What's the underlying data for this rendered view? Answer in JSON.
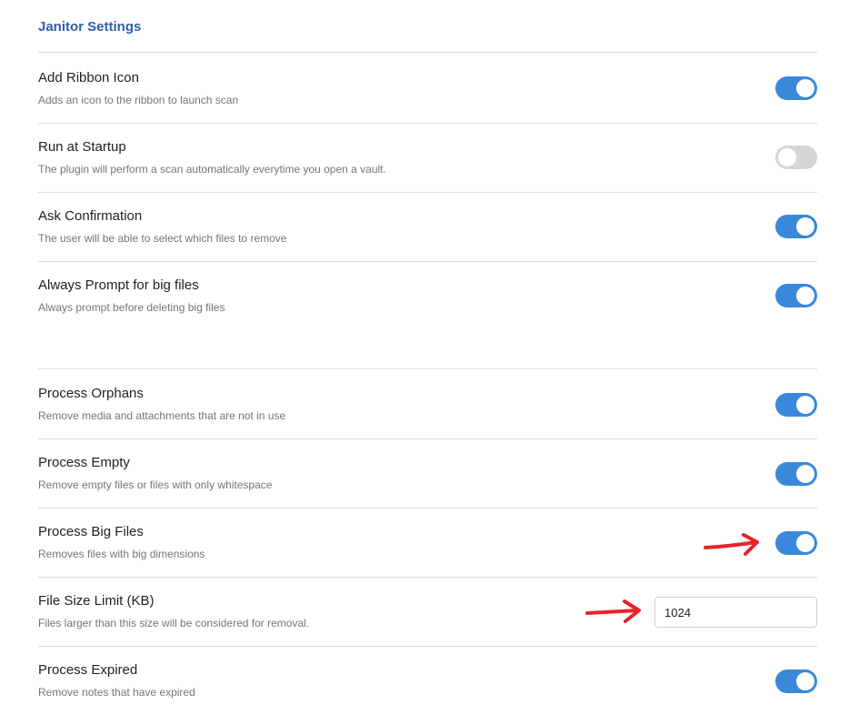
{
  "heading": "Janitor Settings",
  "settings": [
    {
      "name": "Add Ribbon Icon",
      "desc": "Adds an icon to the ribbon to launch scan",
      "enabled": true
    },
    {
      "name": "Run at Startup",
      "desc": "The plugin will perform a scan automatically everytime you open a vault.",
      "enabled": false
    },
    {
      "name": "Ask Confirmation",
      "desc": "The user will be able to select which files to remove",
      "enabled": true
    },
    {
      "name": "Always Prompt for big files",
      "desc": "Always prompt before deleting big files",
      "enabled": true
    },
    {
      "name": "Process Orphans",
      "desc": "Remove media and attachments that are not in use",
      "enabled": true
    },
    {
      "name": "Process Empty",
      "desc": "Remove empty files or files with only whitespace",
      "enabled": true
    },
    {
      "name": "Process Big Files",
      "desc": "Removes files with big dimensions",
      "enabled": true
    },
    {
      "name": "File Size Limit (KB)",
      "desc": "Files larger than this size will be considered for removal.",
      "value": "1024"
    },
    {
      "name": "Process Expired",
      "desc": "Remove notes that have expired",
      "enabled": true
    }
  ],
  "colors": {
    "accent": "#3a88da",
    "toggle_off": "#d6d6d6",
    "heading": "#2e5fa8",
    "annotation_arrow": "#e8232a"
  },
  "annotations": [
    "red-arrow",
    "red-arrow"
  ]
}
